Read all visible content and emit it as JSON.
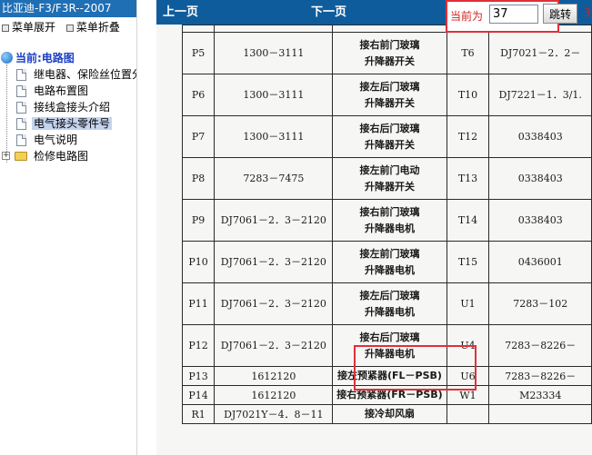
{
  "app": {
    "title": "比亚迪-F3/F3R--2007"
  },
  "menu_ops": {
    "expand": "菜单展开",
    "collapse": "菜单折叠"
  },
  "tree": {
    "root": "当前:电路图",
    "items": [
      "继电器、保险丝位置分",
      "电路布置图",
      "接线盒接头介绍",
      "电气接头零件号",
      "电气说明"
    ],
    "selected_index": 3,
    "folder": "检修电路图"
  },
  "nav": {
    "prev": "上一页",
    "next": "下一页",
    "current_label": "当前为",
    "page_value": "37",
    "jump_label": "跳转",
    "side_number": "3"
  },
  "doc": {
    "rows": [
      {
        "id": "P5",
        "part": "1300－3111",
        "desc": [
          "接右前门玻璃",
          "升降器开关"
        ],
        "id2": "T6",
        "part2": "DJ7021－2．2－"
      },
      {
        "id": "P6",
        "part": "1300－3111",
        "desc": [
          "接左后门玻璃",
          "升降器开关"
        ],
        "id2": "T10",
        "part2": "DJ7221－1．3/1."
      },
      {
        "id": "P7",
        "part": "1300－3111",
        "desc": [
          "接右后门玻璃",
          "升降器开关"
        ],
        "id2": "T12",
        "part2": "0338403"
      },
      {
        "id": "P8",
        "part": "7283－7475",
        "desc": [
          "接左前门电动",
          "升降器开关"
        ],
        "id2": "T13",
        "part2": "0338403"
      },
      {
        "id": "P9",
        "part": "DJ7061－2．3－2120",
        "desc": [
          "接右前门玻璃",
          "升降器电机"
        ],
        "id2": "T14",
        "part2": "0338403"
      },
      {
        "id": "P10",
        "part": "DJ7061－2．3－2120",
        "desc": [
          "接左前门玻璃",
          "升降器电机"
        ],
        "id2": "T15",
        "part2": "0436001"
      },
      {
        "id": "P11",
        "part": "DJ7061－2．3－2120",
        "desc": [
          "接左后门玻璃",
          "升降器电机"
        ],
        "id2": "U1",
        "part2": "7283－102"
      },
      {
        "id": "P12",
        "part": "DJ7061－2．3－2120",
        "desc": [
          "接右后门玻璃",
          "升降器电机"
        ],
        "id2": "U4",
        "part2": "7283－8226－"
      },
      {
        "id": "P13",
        "part": "1612120",
        "desc": [
          "接左预紧器(FL－PSB)"
        ],
        "id2": "U6",
        "part2": "7283－8226－"
      },
      {
        "id": "P14",
        "part": "1612120",
        "desc": [
          "接右预紧器(FR－PSB)"
        ],
        "id2": "W1",
        "part2": "M23334"
      },
      {
        "id": "R1",
        "part": "DJ7021Y－4．8－11",
        "desc": [
          "接冷却风扇"
        ],
        "id2": "",
        "part2": ""
      }
    ]
  },
  "colors": {
    "nav_bg": "#0f5c9c",
    "title_bg": "#1f6fb5",
    "highlight": "#e0303a",
    "root_text": "#1b3fc4"
  }
}
